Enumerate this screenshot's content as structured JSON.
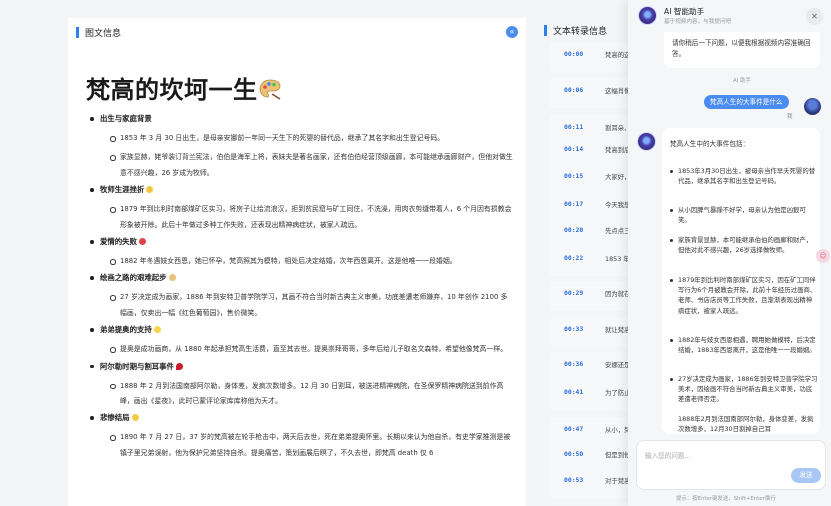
{
  "left": {
    "section_title": "图文信息",
    "collapse_icon": "arrow-icon",
    "doc_title": "梵高的坎坷一生",
    "sections": [
      {
        "heading": "出生与家庭背景",
        "items": [
          "1853 年 3 月 30 日出生，是母亲安娜前一年同一天生下的死婴的替代品，继承了其名字和出生登记号码。",
          "家族显赫，姥爷装订背兰宪法，伯伯是海军上将，表妹夫是著名画家，还有伯伯经营顶级画廊，本可能继承画廊财产，但他对做生意不感兴趣，26 岁成为牧师。"
        ]
      },
      {
        "heading": "牧师生涯挫折",
        "items": [
          "1879 年到比利时南部煤矿区实习，将房子让给流浪汉，拒到贫民窟与矿工同住，不洗澡，用肉衣剪缝带着人，6 个月因有损教会形象被开除。此后十年做过多种工作失败，还表现出精神病症状，被家人疏远。"
        ]
      },
      {
        "heading": "爱情的失败",
        "items": [
          "1882 年冬遇妓女西恩，她已怀孕，梵高照其为模特，相处后决定结婚，次年西恩离开。这是他唯一一段婚姻。"
        ]
      },
      {
        "heading": "绘画之路的艰难起步",
        "items": [
          "27 岁决定成为画家，1886 年到安特卫普学院学习，其画不符合当时新古典主义审美，功底差遭老师嫌弃，10 年创作 2100 多幅画，仅卖出一幅《红色葡萄园》，售价微笑。"
        ]
      },
      {
        "heading": "弟弟提奥的支持",
        "items": [
          "提奥是成功画商，从 1880 年起承担梵高生活费，直至其去世。提奥崇拜哥哥，多年后给儿子取名文森特，希望他像梵高一样。"
        ]
      },
      {
        "heading": "阿尔勒时期与割耳事件",
        "items": [
          "1888 年 2 月到法国南部阿尔勒，身体差，发疯次数增多。12 月 30 日割耳，被送进精神病院，在圣保罗精神病院送到前作高峰，画出《星夜》，此时已蒙评论家库库称他为天才。"
        ]
      },
      {
        "heading": "悲惨结局",
        "items": [
          "1890 年 7 月 27 日，37 岁的梵高被左轮手枪击中，两天后去世，死在弟弟提奥怀里。长期以来认为他自杀，有史学家推测是被镇子里兄弟误射，他为保护兄弟坚持自杀。提奥痛苦，策划画展后瞑了，不久去世，即梵高 death 仅 6"
        ]
      }
    ]
  },
  "mid": {
    "section_title": "文本转录信息",
    "rows": [
      {
        "ts": "00:00",
        "text": "梵高的这辈子是坎坷的一生，他一出生就遭弃"
      },
      {
        "ts": "00:06",
        "text": "这幅肖像画中的人物，在他画画的时候，仍不"
      },
      {
        "ts": "00:11",
        "text": "割耳朵、割"
      },
      {
        "ts": "00:14",
        "text": "梵高到底经"
      },
      {
        "ts": "00:15",
        "text": "大家好，我"
      },
      {
        "ts": "00:17",
        "text": "今天我想"
      },
      {
        "ts": "00:20",
        "text": "先点点三连"
      },
      {
        "ts": "00:22",
        "text": "1853 年 3 月"
      },
      {
        "ts": "00:29",
        "text": "因为就在一"
      },
      {
        "ts": "00:33",
        "text": "就让梵高把"
      },
      {
        "ts": "00:36",
        "text": "安娜还是一"
      },
      {
        "ts": "00:41",
        "text": "为了防止儿"
      },
      {
        "ts": "00:47",
        "text": "从小，梵高"
      },
      {
        "ts": "00:50",
        "text": "但是到他死"
      },
      {
        "ts": "00:53",
        "text": "对于梵高的"
      }
    ]
  },
  "chat": {
    "title": "AI 智能助手",
    "subtitle": "基于视频内容，与我提问吧",
    "close_icon": "close-icon",
    "first_reply": "请你稍后一下问题，以便我根据视频内容准确回答。",
    "ai_tag_1": "AI 助手",
    "user_question": "梵高人生的大事件是什么",
    "me_tag": "我",
    "answer_head": "梵高人生中的大事件包括：",
    "answer_items": [
      "1853年3月30日出生，被母亲当作早夭死婴的替代品，继承其名字和出生登记号码。",
      "从小因脾气暴躁不好学，母亲认为他是凶狠可笑。",
      "家族背景显赫，本可能继承伯伯的画廊和财产，但他对此不感兴趣，26岁选择做牧师。",
      "1879年到比利时南部煤矿区实习，因在矿工同伴写行为6个月被教会开除，此前十年经历过画商、老师、书店店员等工作失败，且渐渐表现出精神病症状，被家人疏远。",
      "1882年与妓女西恩相遇，聘用她做模特，后决定结婚，1883年西恩离开，这是他唯一一段婚姻。",
      "27岁决定成为画家，1886年到安特卫普学院学习美术，因绘画不符合当时新古典主义审美，功底差遭老师否定。",
      "1888年2月到法国南部阿尔勒，身体变差，发疯次数增多，12月30日割掉自己耳"
    ],
    "input_placeholder": "输入您的问题...",
    "send_label": "发送",
    "hint": "提示：按Enter键发送，Shift+Enter换行"
  }
}
